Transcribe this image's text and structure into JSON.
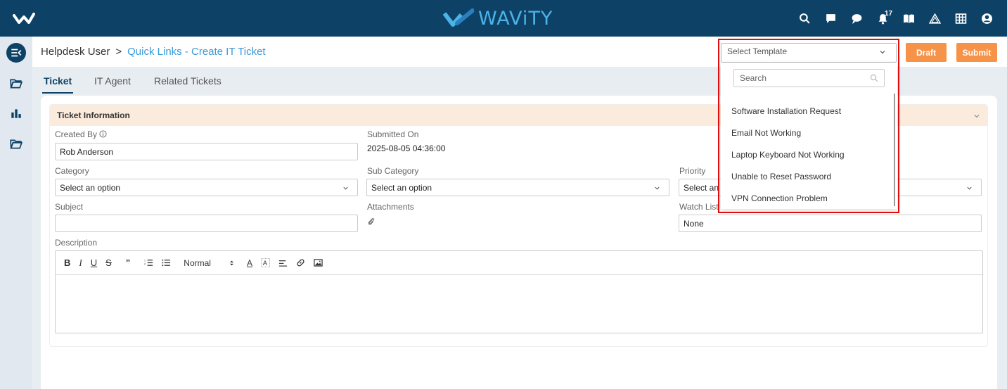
{
  "topbar": {
    "brand": "WAViTY",
    "notification_count": "17",
    "colors": {
      "bar": "#0d4266",
      "brand": "#4bb3e8",
      "accent_button": "#f79348"
    },
    "icons": [
      "search-icon",
      "chat-square-icon",
      "chat-bubble-icon",
      "bell-icon",
      "book-icon",
      "triangle-icon",
      "grid-icon",
      "user-icon"
    ]
  },
  "sidebar": {
    "icons": [
      "sidebar-toggle-icon",
      "folder-open-icon",
      "bar-chart-icon",
      "folder-icon"
    ]
  },
  "header": {
    "breadcrumb_root": "Helpdesk User",
    "breadcrumb_sep": ">",
    "breadcrumb_current": "Quick Links - Create IT Ticket",
    "template_placeholder": "Select Template",
    "draft_label": "Draft",
    "submit_label": "Submit"
  },
  "tabs": [
    {
      "label": "Ticket",
      "active": true
    },
    {
      "label": "IT Agent",
      "active": false
    },
    {
      "label": "Related Tickets",
      "active": false
    }
  ],
  "section": {
    "title": "Ticket Information",
    "created_by_label": "Created By",
    "created_by_value": "Rob Anderson",
    "submitted_on_label": "Submitted On",
    "submitted_on_value": "2025-08-05 04:36:00",
    "category_label": "Category",
    "category_value": "Select an option",
    "sub_category_label": "Sub Category",
    "sub_category_value": "Select an option",
    "priority_label": "Priority",
    "priority_value": "Select an o",
    "subject_label": "Subject",
    "subject_value": "",
    "attachments_label": "Attachments",
    "watch_list_label": "Watch List",
    "watch_list_value": "None",
    "description_label": "Description",
    "editor_format": "Normal"
  },
  "template_dropdown": {
    "search_placeholder": "Search",
    "options": [
      "Software Installation Request",
      "Email Not Working",
      "Laptop Keyboard Not Working",
      "Unable to Reset Password",
      "VPN Connection Problem"
    ]
  }
}
